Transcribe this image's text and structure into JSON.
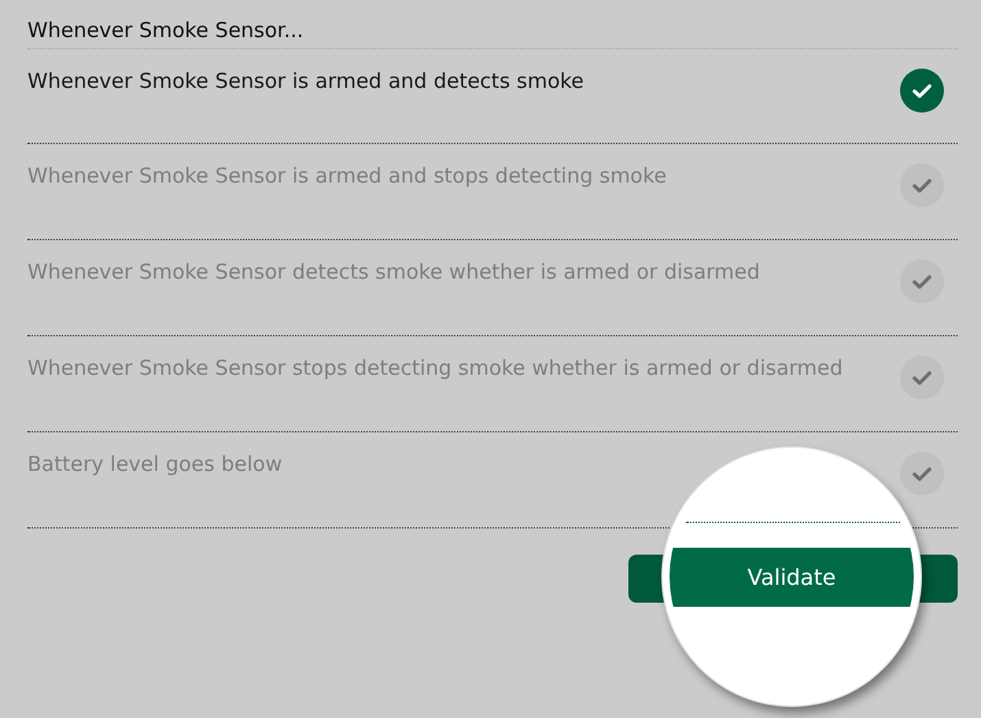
{
  "heading": "Whenever Smoke Sensor...",
  "options": [
    {
      "label": "Whenever Smoke Sensor is armed and detects smoke",
      "selected": true
    },
    {
      "label": "Whenever Smoke Sensor is armed and stops detecting smoke",
      "selected": false
    },
    {
      "label": "Whenever Smoke Sensor detects smoke whether is armed or disarmed",
      "selected": false
    },
    {
      "label": "Whenever Smoke Sensor stops detecting smoke whether is armed or disarmed",
      "selected": false
    },
    {
      "label": "Battery level goes below",
      "selected": false
    }
  ],
  "button": "Validate"
}
